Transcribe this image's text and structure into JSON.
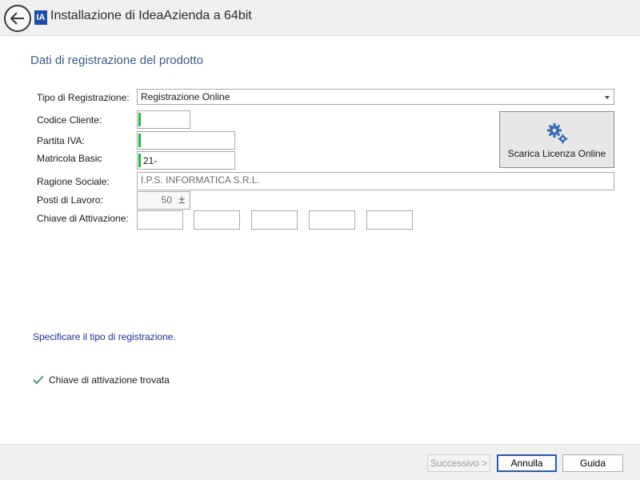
{
  "window": {
    "title": "Installazione di IdeaAzienda a 64bit",
    "icon_text": "IA"
  },
  "section": {
    "title": "Dati di registrazione del prodotto"
  },
  "form": {
    "tipo_label": "Tipo di Registrazione:",
    "tipo_value": "Registrazione Online",
    "codice_cliente_label": "Codice Cliente:",
    "codice_cliente_value": "",
    "partita_iva_label": "Partita IVA:",
    "partita_iva_value": "",
    "matricola_label": "Matricola Basic",
    "matricola_value": "21-",
    "ragione_sociale_label": "Ragione Sociale:",
    "ragione_sociale_value": "I.P.S. INFORMATICA S.R.L.",
    "posti_label": "Posti di Lavoro:",
    "posti_value": "50",
    "posti_spinner_symbol": "±",
    "chiave_label": "Chiave di Attivazione:",
    "chiave_values": [
      "",
      "",
      "",
      "",
      ""
    ]
  },
  "license_button": {
    "label": "Scarica Licenza Online",
    "icon": "gears-icon",
    "icon_color": "#3c6eb4"
  },
  "hint": {
    "text": "Specificare il tipo di registrazione.",
    "color": "#1f2f9a"
  },
  "status": {
    "text": "Chiave di attivazione trovata",
    "icon": "check-icon",
    "icon_color": "#4e9a6b"
  },
  "footer": {
    "next_label": "Successivo >",
    "cancel_label": "Annulla",
    "help_label": "Guida"
  }
}
